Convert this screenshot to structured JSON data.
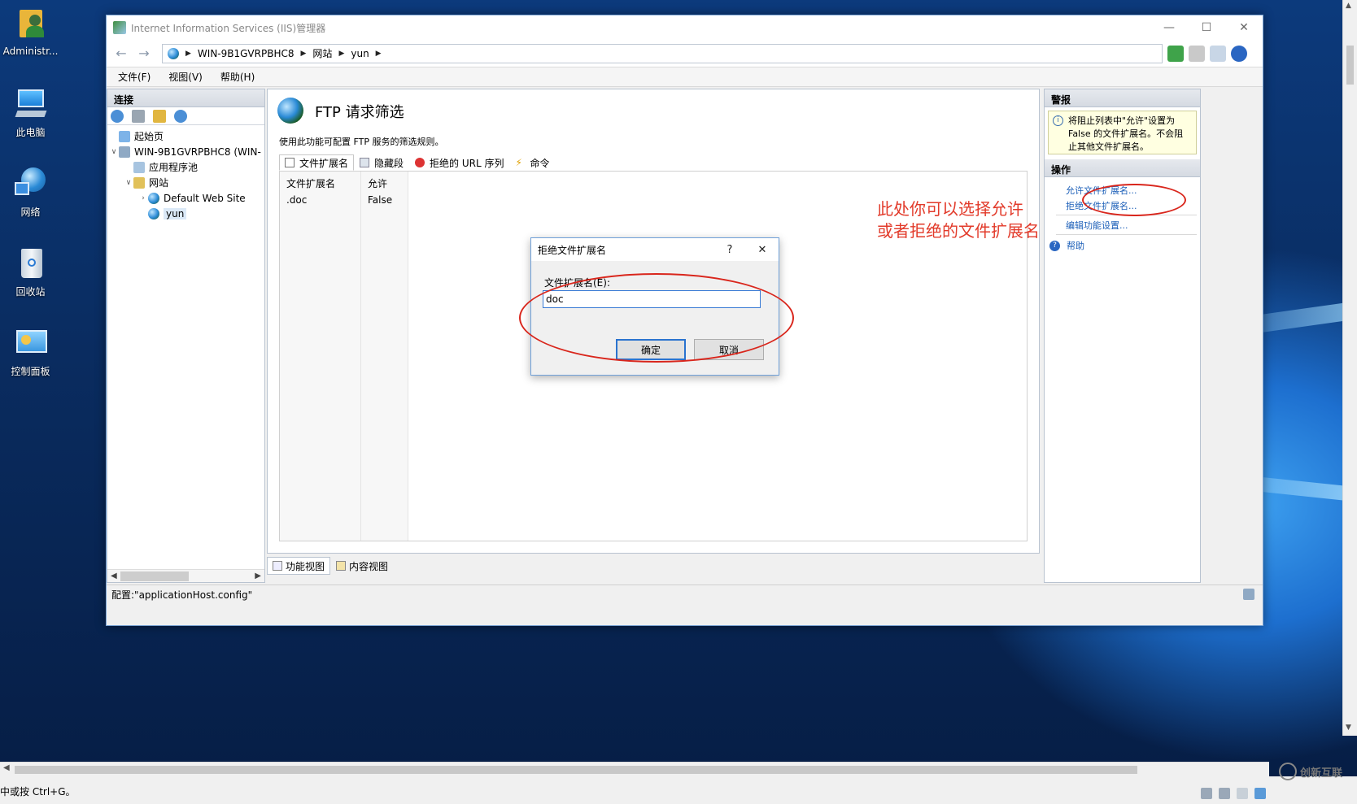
{
  "desktop": {
    "icons": [
      {
        "label": "Administr..."
      },
      {
        "label": "此电脑"
      },
      {
        "label": "网络"
      },
      {
        "label": "回收站"
      },
      {
        "label": "控制面板"
      }
    ]
  },
  "window": {
    "title": "Internet Information Services (IIS)管理器",
    "breadcrumb": [
      "WIN-9B1GVRPBHC8",
      "网站",
      "yun"
    ],
    "menu": [
      "文件(F)",
      "视图(V)",
      "帮助(H)"
    ],
    "status": "配置:\"applicationHost.config\""
  },
  "connections": {
    "header": "连接",
    "tree": [
      {
        "label": "起始页",
        "level": 0
      },
      {
        "label": "WIN-9B1GVRPBHC8 (WIN-",
        "level": 0
      },
      {
        "label": "应用程序池",
        "level": 1
      },
      {
        "label": "网站",
        "level": 1
      },
      {
        "label": "Default Web Site",
        "level": 2
      },
      {
        "label": "yun",
        "level": 2
      }
    ]
  },
  "feature": {
    "title": "FTP 请求筛选",
    "description": "使用此功能可配置 FTP 服务的筛选规则。",
    "tabs": [
      "文件扩展名",
      "隐藏段",
      "拒绝的 URL 序列",
      "命令"
    ],
    "columns": [
      "文件扩展名",
      "允许"
    ],
    "rows": [
      {
        "ext": ".doc",
        "allowed": "False"
      }
    ]
  },
  "view_tabs": [
    "功能视图",
    "内容视图"
  ],
  "actions": {
    "alerts_header": "警报",
    "alert_text": "将阻止列表中\"允许\"设置为 False 的文件扩展名。不会阻止其他文件扩展名。",
    "ops_header": "操作",
    "links": [
      "允许文件扩展名...",
      "拒绝文件扩展名...",
      "编辑功能设置..."
    ],
    "help": "帮助"
  },
  "dialog": {
    "title": "拒绝文件扩展名",
    "help_glyph": "?",
    "label": "文件扩展名(E):",
    "value": "doc",
    "ok": "确定",
    "cancel": "取消"
  },
  "annotation": {
    "line1": "此处你可以选择允许",
    "line2": "或者拒绝的文件扩展名"
  },
  "bottom": {
    "text": "中或按 Ctrl+G。"
  },
  "watermark": {
    "text": "创新互联"
  },
  "colors": {
    "annotation": "#e23a2a",
    "link": "#1a5eb8",
    "accent": "#2a73cf"
  }
}
